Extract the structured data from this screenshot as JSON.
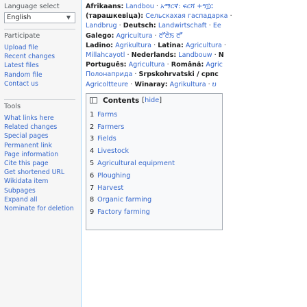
{
  "sidebar": {
    "language_heading": "Language select",
    "language_value": "English",
    "participate_heading": "Participate",
    "participate_items": [
      "Upload file",
      "Recent changes",
      "Latest files",
      "Random file",
      "Contact us"
    ],
    "tools_heading": "Tools",
    "tools_items": [
      "What links here",
      "Related changes",
      "Special pages",
      "Permanent link",
      "Page information",
      "Cite this page",
      "Get shortened URL",
      "Wikidata item",
      "Subpages",
      "Expand all",
      "Nominate for deletion"
    ]
  },
  "interwiki": [
    [
      {
        "lang": "Afrikaans:",
        "term": "Landbou"
      },
      {
        "lang": "",
        "term": "አማርኛ: ",
        "extra": "ፍርሻ +ዓ፲ር"
      }
    ],
    [
      {
        "lang": "(тарашкевіца):",
        "term": "Сельскахая гаспадарка"
      }
    ],
    [
      {
        "lang": "",
        "term": "Landbrug"
      },
      {
        "lang": "Deutsch:",
        "term": "Landwirtschaft"
      },
      {
        "lang": "",
        "term": "Ee"
      }
    ],
    [
      {
        "lang": "Galego:",
        "term": "Agricultura"
      },
      {
        "lang": "",
        "term": "ꯂꯧꯂꯥꯏ"
      },
      {
        "lang": "",
        "term": "ꯂꯧ"
      }
    ],
    [
      {
        "lang": "Ladino:",
        "term": "Agrikultura"
      },
      {
        "lang": "Latina:",
        "term": "Agricultura"
      }
    ],
    [
      {
        "lang": "",
        "term": "Millahcayotl"
      },
      {
        "lang": "Nederlands:",
        "term": "Landbouw"
      },
      {
        "lang": "N",
        "term": ""
      }
    ],
    [
      {
        "lang": "Português:",
        "term": "Agricultura"
      },
      {
        "lang": "Română:",
        "term": "Agric"
      }
    ],
    [
      {
        "lang": "",
        "term": "Полонаприда"
      },
      {
        "lang": "Srpskohrvatski / српс",
        "term": ""
      }
    ],
    [
      {
        "lang": "",
        "term": "Agricoltteure"
      },
      {
        "lang": "Winaray:",
        "term": "Agrikultura"
      },
      {
        "lang": "",
        "term": "ບ"
      }
    ]
  ],
  "toc": {
    "title": "Contents",
    "toggle_open": "[",
    "toggle_label": "hide",
    "toggle_close": "]",
    "items": [
      {
        "num": "1",
        "label": "Farms"
      },
      {
        "num": "2",
        "label": "Farmers"
      },
      {
        "num": "3",
        "label": "Fields"
      },
      {
        "num": "4",
        "label": "Livestock"
      },
      {
        "num": "5",
        "label": "Agricultural equipment"
      },
      {
        "num": "6",
        "label": "Ploughing"
      },
      {
        "num": "7",
        "label": "Harvest"
      },
      {
        "num": "8",
        "label": "Organic farming"
      },
      {
        "num": "9",
        "label": "Factory farming"
      }
    ]
  }
}
